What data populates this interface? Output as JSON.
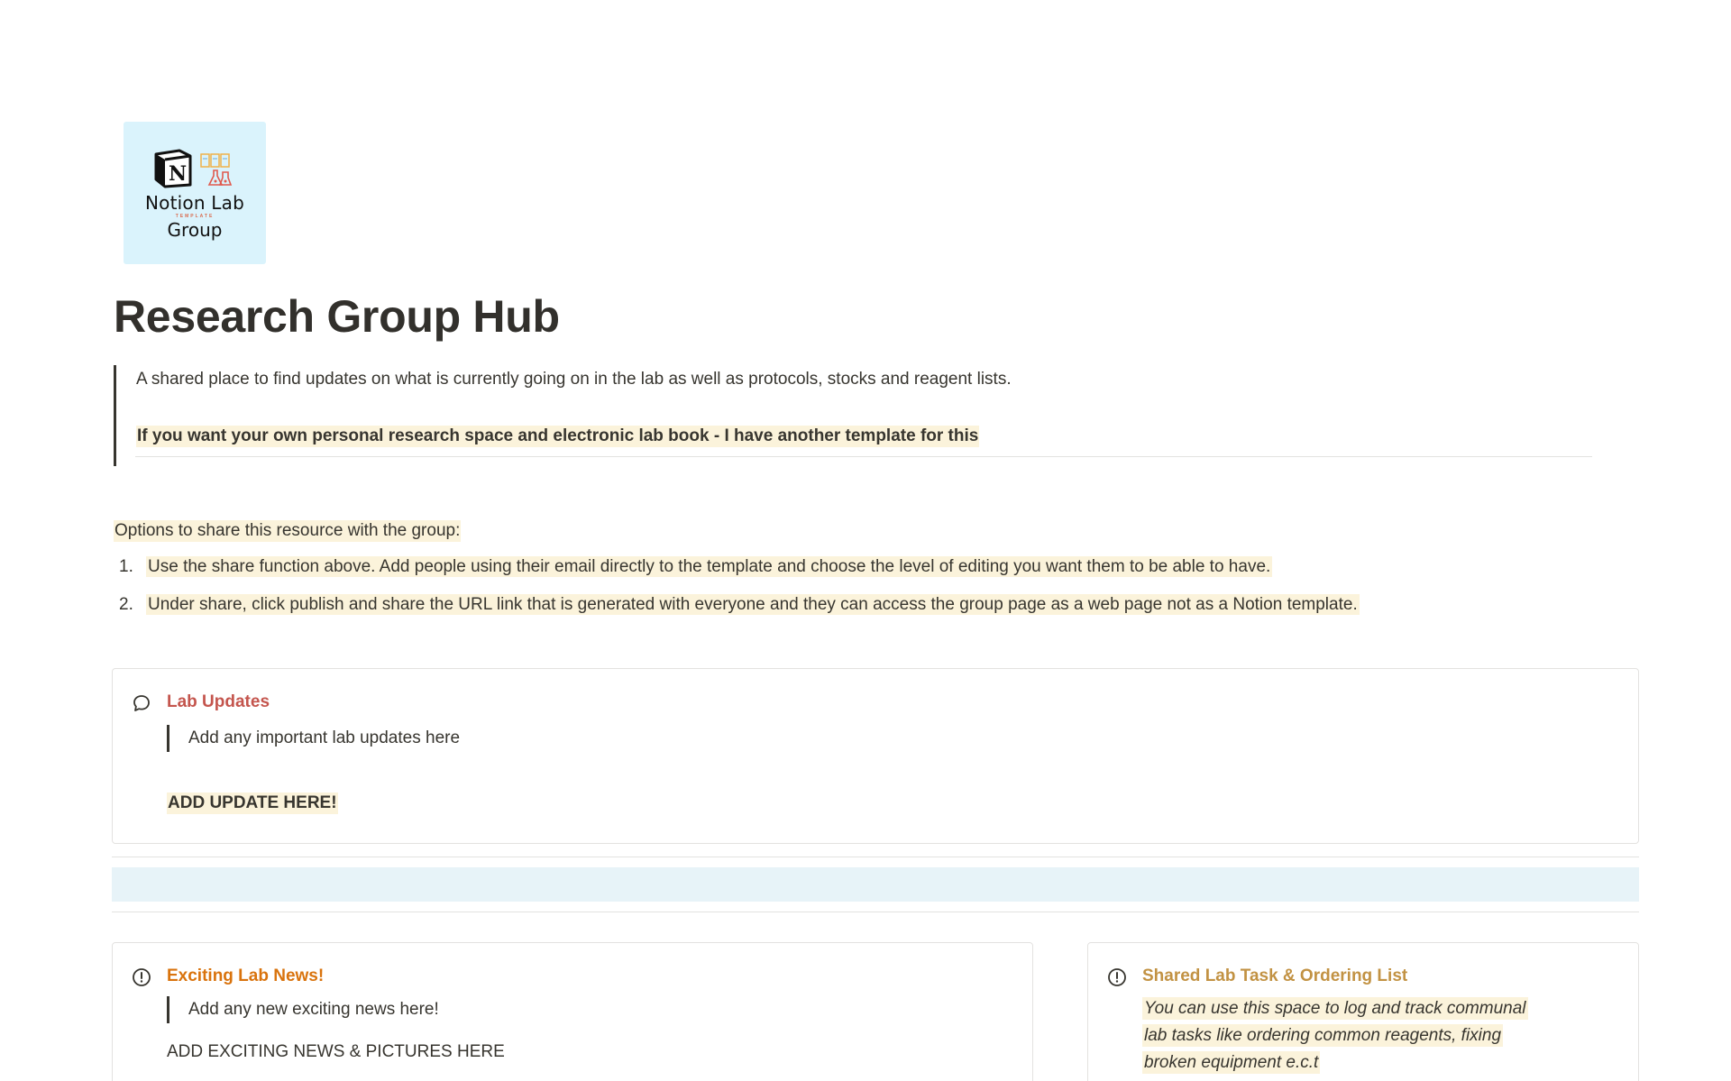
{
  "logo": {
    "mark_letter": "N",
    "line1": "Notion Lab",
    "line2": "TEMPLATE",
    "line3": "Group"
  },
  "page": {
    "title": "Research Group Hub"
  },
  "intro": {
    "description": "A shared place to find updates on what is currently going on in the lab as well as protocols, stocks and reagent lists.",
    "highlight": "If you want your own personal research space and electronic lab book - I have another template for this"
  },
  "options": {
    "intro": "Options to share this resource with the group:",
    "items": [
      {
        "num": "1.",
        "text": "Use the share function above. Add people using their email directly to the template and choose the level of editing you want them to be able to have."
      },
      {
        "num": "2.",
        "text": "Under share, click publish and share the URL link that is generated with everyone and they can access the group page as a web page not as a Notion template."
      }
    ]
  },
  "callouts": {
    "updates": {
      "icon": "speech-bubble-icon",
      "title": "Lab Updates",
      "quote": "Add any important lab updates here",
      "action": "ADD UPDATE HERE!"
    },
    "news": {
      "icon": "exclamation-circle-icon",
      "title": "Exciting Lab News!",
      "quote": "Add any new exciting news here!",
      "action": "ADD EXCITING NEWS & PICTURES HERE"
    },
    "tasks": {
      "icon": "exclamation-circle-icon",
      "title": "Shared Lab Task & Ordering List",
      "lines": [
        "You can use this space to log and track communal",
        "lab tasks like ordering common reagents, fixing",
        "broken equipment e.c.t"
      ]
    }
  },
  "colors": {
    "text": "#37352f",
    "highlight_bg": "#fbf3db",
    "red_title": "#c4554d",
    "orange_title": "#d9730d",
    "yellow_title": "#c29243",
    "blue_band": "#e7f3f8",
    "logo_bg": "#daf3fc"
  }
}
